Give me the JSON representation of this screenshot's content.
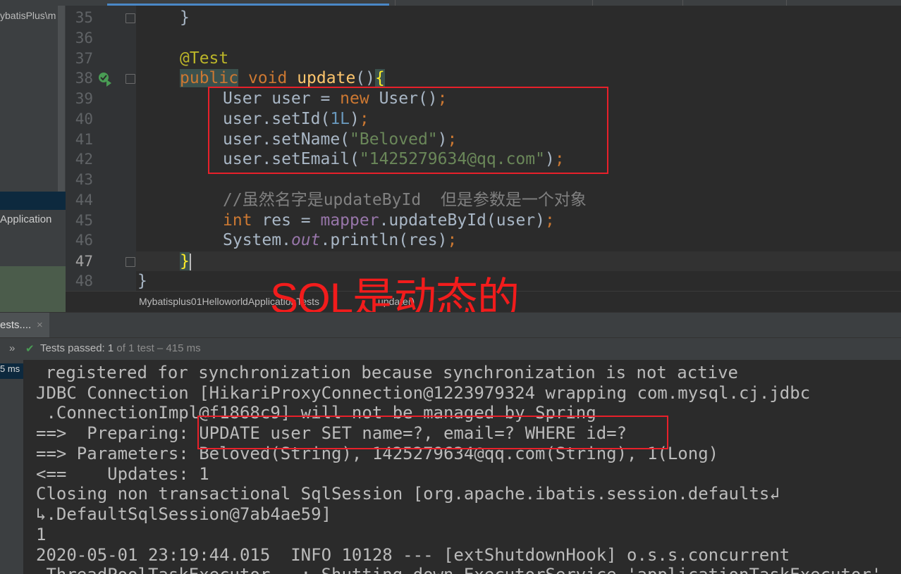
{
  "project": {
    "path": "ybatisPlus\\m",
    "selected_item": "Application"
  },
  "gutter": {
    "lines": [
      "35",
      "36",
      "37",
      "38",
      "39",
      "40",
      "41",
      "42",
      "43",
      "44",
      "45",
      "46",
      "47",
      "48"
    ]
  },
  "code": {
    "l35": "}",
    "l37": "@Test",
    "l38_kw1": "public",
    "l38_kw2": "void",
    "l38_name": "update",
    "l38_paren": "()",
    "l38_brace": "{",
    "l39_type": "User user = ",
    "l39_new": "new",
    "l39_rest": " User()",
    "semicolon": ";",
    "l40_a": "user.setId(",
    "l40_num": "1L",
    "l40_b": ")",
    "l41_a": "user.setName(",
    "l41_str": "\"Beloved\"",
    "l41_b": ")",
    "l42_a": "user.setEmail(",
    "l42_str": "\"1425279634@qq.com\"",
    "l42_b": ")",
    "l44_comment": "//虽然名字是updateById  但是参数是一个对象",
    "l45_kw": "int",
    "l45_a": " res = ",
    "l45_field": "mapper",
    "l45_b": ".updateById(user)",
    "l46_a": "System.",
    "l46_field": "out",
    "l46_b": ".println(res)",
    "l47_brace": "}",
    "l48_brace": "}"
  },
  "breadcrumb": {
    "class": "Mybatisplus01HelloworldApplicationTests",
    "method": "update()"
  },
  "overlay_note": "SQL是动态的",
  "run_tab": {
    "label": "ests....",
    "close": "×"
  },
  "status": {
    "prefix": "»",
    "check": "✔",
    "text": "Tests passed: ",
    "count": "1",
    "rest": " of 1 test – 415 ms"
  },
  "console_side": {
    "time": "5 ms"
  },
  "console": {
    "lines": [
      " registered for synchronization because synchronization is not active",
      "JDBC Connection [HikariProxyConnection@1223979324 wrapping com.mysql.cj.jdbc",
      " .ConnectionImpl@f1868c9] will not be managed by Spring",
      "==>  Preparing: UPDATE user SET name=?, email=? WHERE id=?",
      "==> Parameters: Beloved(String), 1425279634@qq.com(String), 1(Long)",
      "<==    Updates: 1",
      "Closing non transactional SqlSession [org.apache.ibatis.session.defaults↲",
      "↳.DefaultSqlSession@7ab4ae59]",
      "1",
      "2020-05-01 23:19:44.015  INFO 10128 --- [extShutdownHook] o.s.s.concurrent",
      ".ThreadPoolTaskExecutor   : Shutting down ExecutorService 'applicationTaskExecutor'"
    ]
  },
  "colors": {
    "annotation_red": "#e8202a",
    "background": "#2b2b2b"
  }
}
